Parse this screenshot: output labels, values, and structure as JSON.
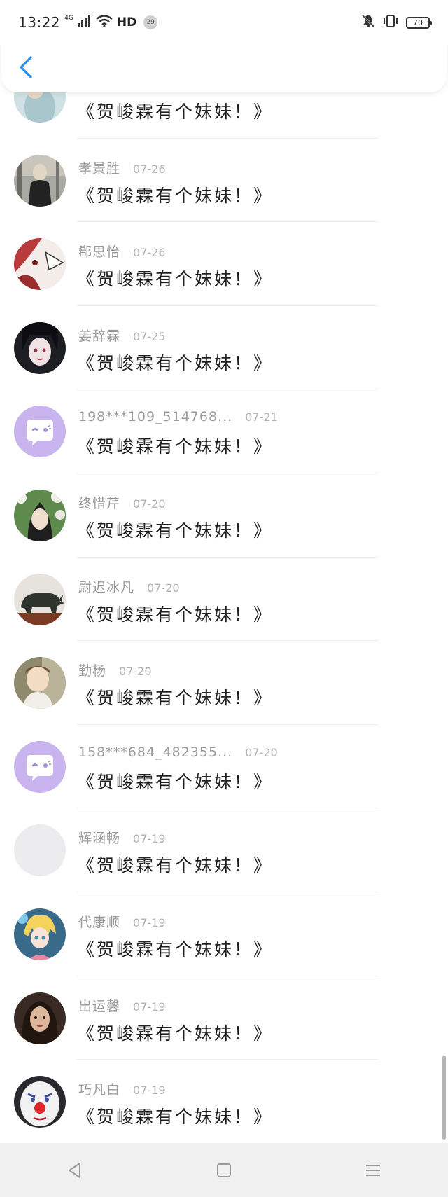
{
  "status_bar": {
    "time": "13:22",
    "network": "4G",
    "hd": "HD",
    "badge": "29",
    "battery": "70"
  },
  "colors": {
    "accent": "#2a8fe8",
    "name_text": "#9a9a9a",
    "message_text": "#1f1f1f",
    "default_avatar": "#c9b4f0"
  },
  "comments": [
    {
      "name": "",
      "date": "",
      "message": "《贺峻霖有个妹妹！》",
      "avatar": "photo-partial"
    },
    {
      "name": "孝景胜",
      "date": "07-26",
      "message": "《贺峻霖有个妹妹！》",
      "avatar": "photo-girl-back"
    },
    {
      "name": "郗思怡",
      "date": "07-26",
      "message": "《贺峻霖有个妹妹！》",
      "avatar": "anime-red"
    },
    {
      "name": "姜辞霖",
      "date": "07-25",
      "message": "《贺峻霖有个妹妹！》",
      "avatar": "anime-dark"
    },
    {
      "name": "198***109_514768...",
      "date": "07-21",
      "message": "《贺峻霖有个妹妹！》",
      "avatar": "default-chat"
    },
    {
      "name": "终惜芹",
      "date": "07-20",
      "message": "《贺峻霖有个妹妹！》",
      "avatar": "photo-flower-girl"
    },
    {
      "name": "尉迟冰凡",
      "date": "07-20",
      "message": "《贺峻霖有个妹妹！》",
      "avatar": "rhino-statue"
    },
    {
      "name": "勤杨",
      "date": "07-20",
      "message": "《贺峻霖有个妹妹！》",
      "avatar": "photo-child"
    },
    {
      "name": "158***684_482355...",
      "date": "07-20",
      "message": "《贺峻霖有个妹妹！》",
      "avatar": "default-chat"
    },
    {
      "name": "辉涵畅",
      "date": "07-19",
      "message": "《贺峻霖有个妹妹！》",
      "avatar": "blank-gray"
    },
    {
      "name": "代康顺",
      "date": "07-19",
      "message": "《贺峻霖有个妹妹！》",
      "avatar": "anime-blond"
    },
    {
      "name": "出运馨",
      "date": "07-19",
      "message": "《贺峻霖有个妹妹！》",
      "avatar": "photo-woman"
    },
    {
      "name": "巧凡白",
      "date": "07-19",
      "message": "《贺峻霖有个妹妹！》",
      "avatar": "clown-face"
    }
  ],
  "nav": {
    "back": "back-triangle-icon",
    "home": "home-square-icon",
    "menu": "menu-lines-icon"
  }
}
